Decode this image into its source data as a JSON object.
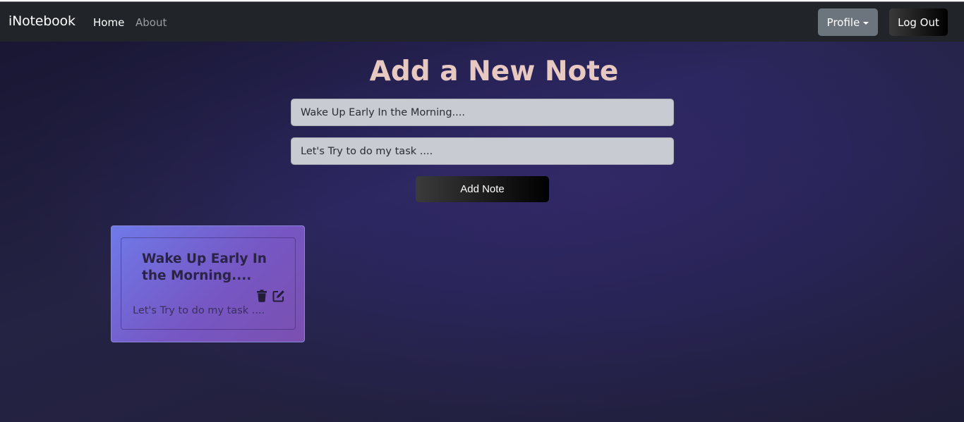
{
  "navbar": {
    "brand": "iNotebook",
    "links": [
      {
        "label": "Home"
      },
      {
        "label": "About"
      }
    ],
    "profile_label": "Profile",
    "logout_label": "Log Out"
  },
  "form": {
    "heading": "Add a New Note",
    "title_value": "Wake Up Early In the Morning....",
    "description_value": "Let's Try to do my task ....",
    "submit_label": "Add Note"
  },
  "notes": [
    {
      "title": "Wake Up Early In the Morning....",
      "description": "Let's Try to do my task ....",
      "icons": [
        "trash-icon",
        "edit-icon"
      ]
    }
  ],
  "colors": {
    "navbar_bg": "#212529",
    "profile_btn": "#6c757d",
    "heading": "#e8c9c2",
    "card_gradient_start": "#6f7ae9",
    "card_gradient_end": "#7b4fb0"
  }
}
